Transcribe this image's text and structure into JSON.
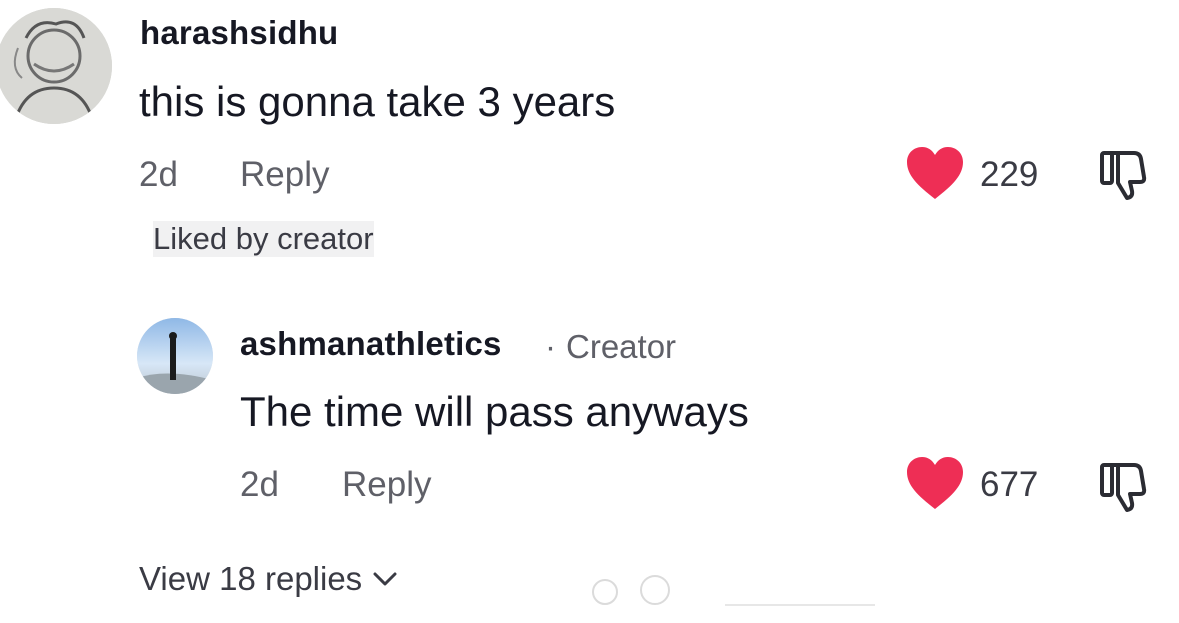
{
  "comments": [
    {
      "username": "harashsidhu",
      "text": "this is gonna take 3 years",
      "time": "2d",
      "reply_label": "Reply",
      "liked_by": "Liked by creator",
      "likes": "229",
      "heart_color": "#ee2e55"
    },
    {
      "username": "ashmanathletics",
      "creator_dot": "·",
      "creator_label": "Creator",
      "text": "The time will pass anyways",
      "time": "2d",
      "reply_label": "Reply",
      "likes": "677",
      "heart_color": "#ee2e55"
    }
  ],
  "view_replies": "View 18 replies",
  "icons": {
    "heart": "heart-icon",
    "dislike": "thumbs-down-icon",
    "chevron": "chevron-down-icon"
  }
}
